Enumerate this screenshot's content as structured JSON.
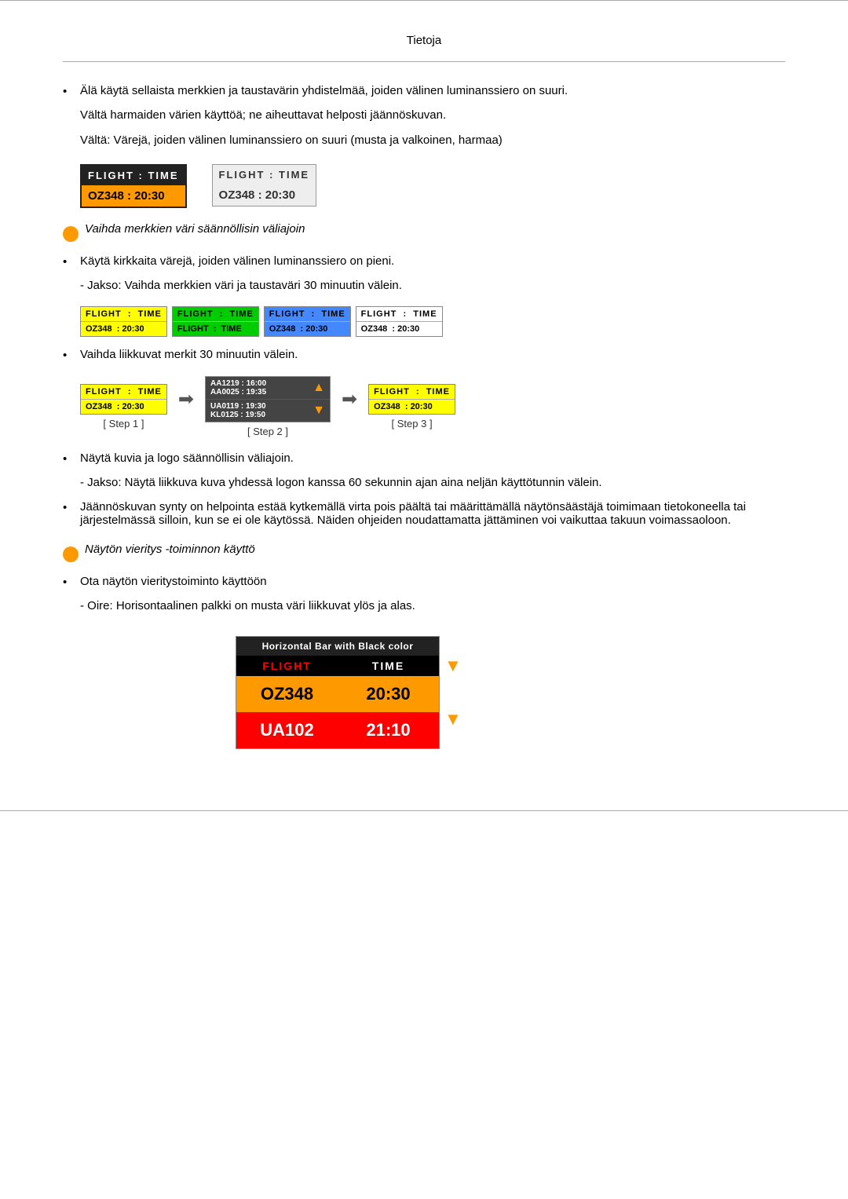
{
  "page": {
    "title": "Tietoja"
  },
  "content": {
    "bullet1": {
      "text": "Älä käytä sellaista merkkien ja taustavärin yhdistelmää, joiden välinen luminanssiero on suuri.",
      "sub1": "Vältä harmaiden värien käyttöä; ne aiheuttavat helposti jäännöskuvan.",
      "sub2": "Vältä: Värejä, joiden välinen luminanssiero on suuri (musta ja valkoinen, harmaa)"
    },
    "flight_box_dark_header": "FLIGHT  :  TIME",
    "flight_box_dark_data": "OZ348   :  20:30",
    "flight_box_gray_header": "FLIGHT  :  TIME",
    "flight_box_gray_data": "OZ348   :  20:30",
    "orange_heading1": "Vaihda merkkien väri säännöllisin väliajoin",
    "bullet2": {
      "text": "Käytä kirkkaita värejä, joiden välinen luminanssiero on pieni.",
      "sub1": "- Jakso: Vaihda merkkien väri ja taustaväri 30 minuutin välein."
    },
    "cycling_boxes": [
      {
        "header": "FLIGHT  :  TIME",
        "data": "OZ348   :  20:30",
        "color": "yellow"
      },
      {
        "header": "FLIGHT  :  TIME",
        "data": "FLIGHT  :  TIME",
        "color": "green"
      },
      {
        "header": "FLIGHT  :  TIME",
        "data": "OZ348   :  20:30",
        "color": "blue"
      },
      {
        "header": "FLIGHT  :  TIME",
        "data": "OZ348   :  20:30",
        "color": "white"
      }
    ],
    "bullet3": {
      "text": "Vaihda liikkuvat merkit 30 minuutin välein."
    },
    "step_labels": [
      "[ Step 1 ]",
      "[ Step 2 ]",
      "[ Step 3 ]"
    ],
    "step1_header": "FLIGHT  :  TIME",
    "step1_data": "OZ348   :  20:30",
    "step2_header": "AA1219 :  16:00  AA0025 :  19:35",
    "step2_data": "UA0119 :  19:30  KL0125 :  19:50",
    "step3_header": "FLIGHT  :  TIME",
    "step3_data": "OZ348   :  20:30",
    "bullet4": {
      "text": "Näytä kuvia ja logo säännöllisin väliajoin.",
      "sub1": "- Jakso: Näytä liikkuva kuva yhdessä logon kanssa 60 sekunnin ajan aina neljän käyttötunnin välein."
    },
    "bullet5": {
      "text": "Jäännöskuvan synty on helpointa estää kytkemällä virta pois päältä tai määrittämällä näytönsäästäjä toimimaan tietokoneella tai järjestelmässä silloin, kun se ei ole käytössä. Näiden ohjeiden noudattamatta jättäminen voi vaikuttaa takuun voimassaoloon."
    },
    "orange_heading2": "Näytön vieritys -toiminnon käyttö",
    "bullet6": {
      "text": "Ota näytön vieritystoiminto käyttöön",
      "sub1": "- Oire: Horisontaalinen palkki on musta väri liikkuvat ylös ja alas."
    },
    "scroll_box": {
      "header_title": "Horizontal Bar with Black color",
      "col1": "FLIGHT",
      "col2": "TIME",
      "row1_flight": "OZ348",
      "row1_time": "20:30",
      "row2_flight": "UA102",
      "row2_time": "21:10"
    }
  }
}
